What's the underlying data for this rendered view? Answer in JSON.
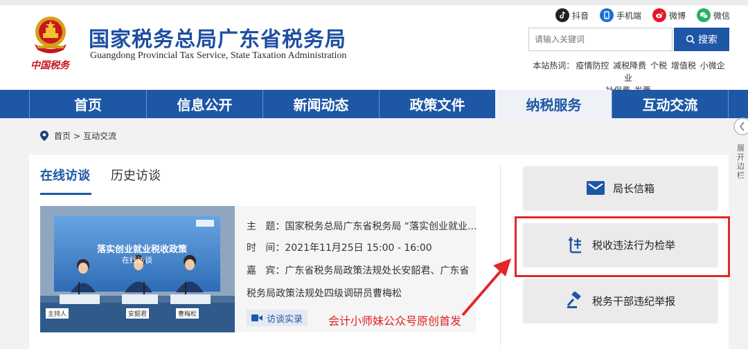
{
  "header": {
    "emblem_caption": "中国税务",
    "title": "国家税务总局广东省税务局",
    "subtitle": "Guangdong Provincial Tax Service, State Taxation Administration",
    "social": [
      {
        "label": "抖音",
        "icon": "douyin-icon",
        "color": "#222222"
      },
      {
        "label": "手机端",
        "icon": "mobile-icon",
        "color": "#1d6fd6"
      },
      {
        "label": "微博",
        "icon": "weibo-icon",
        "color": "#e6162d"
      },
      {
        "label": "微信",
        "icon": "wechat-icon",
        "color": "#2aae67"
      }
    ],
    "search": {
      "placeholder": "请输入关键词",
      "button_label": "搜索"
    },
    "hot_label": "本站热词：",
    "hot_words": [
      "疫情防控",
      "减税降费",
      "个税",
      "增值税",
      "小微企业",
      "社保费",
      "发票"
    ]
  },
  "nav": {
    "items": [
      "首页",
      "信息公开",
      "新闻动态",
      "政策文件",
      "纳税服务",
      "互动交流"
    ],
    "active_index": 4,
    "accent": "#1d57a6"
  },
  "breadcrumb": {
    "home": "首页",
    "separator": ">",
    "current": "互动交流"
  },
  "interviews": {
    "tabs": [
      "在线访谈",
      "历史访谈"
    ],
    "photo_banner": "落实创业就业税收政策",
    "photo_banner_line2": "在线访谈",
    "name_cards": [
      "主持人",
      "安韶君",
      "曹梅松"
    ],
    "subject_label": "主   题：",
    "subject": "国家税务总局广东省税务局 “落实创业就业...",
    "time_label": "时   间：",
    "time": "2021年11月25日 15:00 - 16:00",
    "guests_label": "嘉   宾：",
    "guests_line1": "广东省税务局政策法规处长安韶君、广东省",
    "guests_line2": "税务局政策法规处四级调研员曹梅松",
    "record_button": "访谈实录",
    "watermark": "会计小师妹公众号原创首发"
  },
  "side": {
    "buttons": [
      "局长信箱",
      "税收违法行为检举",
      "税务干部违纪举报"
    ],
    "highlight_color": "#e3262a"
  },
  "expand_label": "展开边栏"
}
